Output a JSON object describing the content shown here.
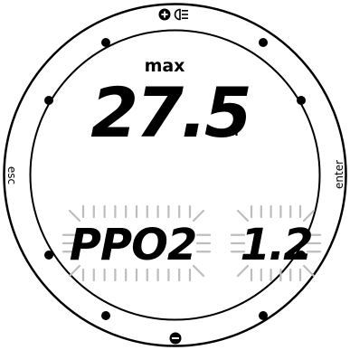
{
  "bezel": {
    "top_button": "plus-backlight",
    "bottom_button": "minus",
    "left_label": "esc",
    "right_label": "enter"
  },
  "display": {
    "max_label": "max",
    "depth_value": "27.5",
    "depth_unit": "m",
    "param_label": "PPO2",
    "param_value": "1.2",
    "blinking": true
  },
  "colors": {
    "ink": "#000000",
    "background": "#ffffff",
    "blink_ray": "#bdbdbd"
  }
}
